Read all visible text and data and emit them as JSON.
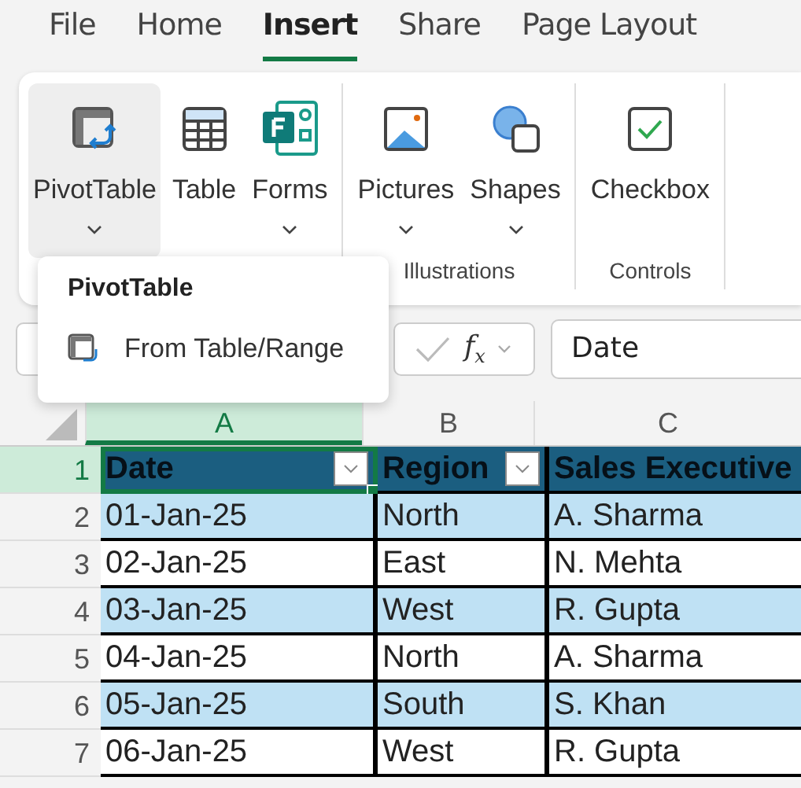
{
  "tabs": [
    {
      "label": "File",
      "selected": false
    },
    {
      "label": "Home",
      "selected": false
    },
    {
      "label": "Insert",
      "selected": true
    },
    {
      "label": "Share",
      "selected": false
    },
    {
      "label": "Page Layout",
      "selected": false
    }
  ],
  "ribbon": {
    "groups": [
      {
        "buttons": [
          {
            "kind": "pivot",
            "label": "PivotTable",
            "has_menu": true,
            "expanded": true
          },
          {
            "kind": "table",
            "label": "Table",
            "has_menu": false,
            "expanded": false
          },
          {
            "kind": "forms",
            "label": "Forms",
            "has_menu": true,
            "expanded": false
          }
        ]
      },
      {
        "label": "Illustrations",
        "buttons": [
          {
            "kind": "pictures",
            "label": "Pictures",
            "has_menu": true,
            "expanded": false
          },
          {
            "kind": "shapes",
            "label": "Shapes",
            "has_menu": true,
            "expanded": false
          }
        ]
      },
      {
        "label": "Controls",
        "buttons": [
          {
            "kind": "checkbox",
            "label": "Checkbox",
            "has_menu": false,
            "expanded": false
          }
        ]
      }
    ]
  },
  "menu": {
    "title": "PivotTable",
    "items": [
      {
        "label": "From Table/Range"
      }
    ]
  },
  "formula_bar": {
    "function_symbol": "f$_{x}$",
    "formula": "Date"
  },
  "sheet": {
    "columns": [
      {
        "label": "A",
        "selected": true
      },
      {
        "label": "B",
        "selected": false
      },
      {
        "label": "C",
        "selected": false
      }
    ],
    "header_row": {
      "number": "1",
      "selected": true,
      "cells": [
        {
          "text": "Date",
          "filter": true,
          "selected": true
        },
        {
          "text": "Region",
          "filter": true,
          "selected": false
        },
        {
          "text": "Sales Executive",
          "filter": false,
          "selected": false
        }
      ]
    },
    "rows": [
      {
        "number": "2",
        "selected": false,
        "cells": [
          "01-Jan-25",
          "North",
          "A. Sharma"
        ]
      },
      {
        "number": "3",
        "selected": false,
        "cells": [
          "02-Jan-25",
          "East",
          "N. Mehta"
        ]
      },
      {
        "number": "4",
        "selected": false,
        "cells": [
          "03-Jan-25",
          "West",
          "R. Gupta"
        ]
      },
      {
        "number": "5",
        "selected": false,
        "cells": [
          "04-Jan-25",
          "North",
          "A. Sharma"
        ]
      },
      {
        "number": "6",
        "selected": false,
        "cells": [
          "05-Jan-25",
          "South",
          "S. Khan"
        ]
      },
      {
        "number": "7",
        "selected": false,
        "cells": [
          "06-Jan-25",
          "West",
          "R. Gupta"
        ]
      }
    ]
  }
}
